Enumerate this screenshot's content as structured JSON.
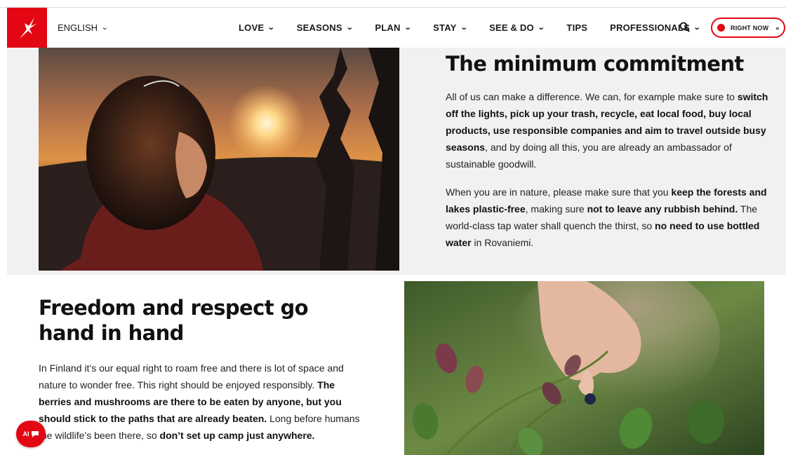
{
  "header": {
    "language": "ENGLISH",
    "nav": [
      {
        "label": "LOVE",
        "dropdown": true
      },
      {
        "label": "SEASONS",
        "dropdown": true
      },
      {
        "label": "PLAN",
        "dropdown": true
      },
      {
        "label": "STAY",
        "dropdown": true
      },
      {
        "label": "SEE & DO",
        "dropdown": true
      },
      {
        "label": "TIPS",
        "dropdown": false
      },
      {
        "label": "PROFESSIONALS",
        "dropdown": true
      }
    ],
    "right_now_label": "RIGHT NOW",
    "right_now_arrow": "»",
    "brand_color": "#e30613"
  },
  "section1": {
    "title": "The minimum commitment",
    "para1": [
      {
        "text": "All of us can make a difference. We can, for example make sure to ",
        "bold": false
      },
      {
        "text": "switch off the lights, pick up your trash, recycle, eat local food, buy local products, use responsible companies and aim to travel outside busy seasons",
        "bold": true
      },
      {
        "text": ", and by doing all this, you are already an ambassador of sustainable goodwill.",
        "bold": false
      }
    ],
    "para2": [
      {
        "text": "When you are in nature, please make sure that you ",
        "bold": false
      },
      {
        "text": "keep the forests and lakes plastic-free",
        "bold": true
      },
      {
        "text": ", making sure ",
        "bold": false
      },
      {
        "text": "not to leave any rubbish behind.",
        "bold": true
      },
      {
        "text": " The world-class tap water shall quench the thirst, so ",
        "bold": false
      },
      {
        "text": "no need to use bottled water",
        "bold": true
      },
      {
        "text": " in Rovaniemi.",
        "bold": false
      }
    ]
  },
  "section2": {
    "title": "Freedom and respect go hand in hand",
    "para1": [
      {
        "text": "In Finland it’s our equal right to roam free and there is lot of space and nature to wonder free. This right should be enjoyed responsibly. ",
        "bold": false
      },
      {
        "text": "The berries and mushrooms are there to be eaten by anyone, but you should stick to the paths that are already beaten.",
        "bold": true
      },
      {
        "text": " Long before humans the wildlife’s been there, so ",
        "bold": false
      },
      {
        "text": "don’t set up camp just anywhere.",
        "bold": true
      }
    ]
  },
  "chat_badge": {
    "label": "AI"
  }
}
